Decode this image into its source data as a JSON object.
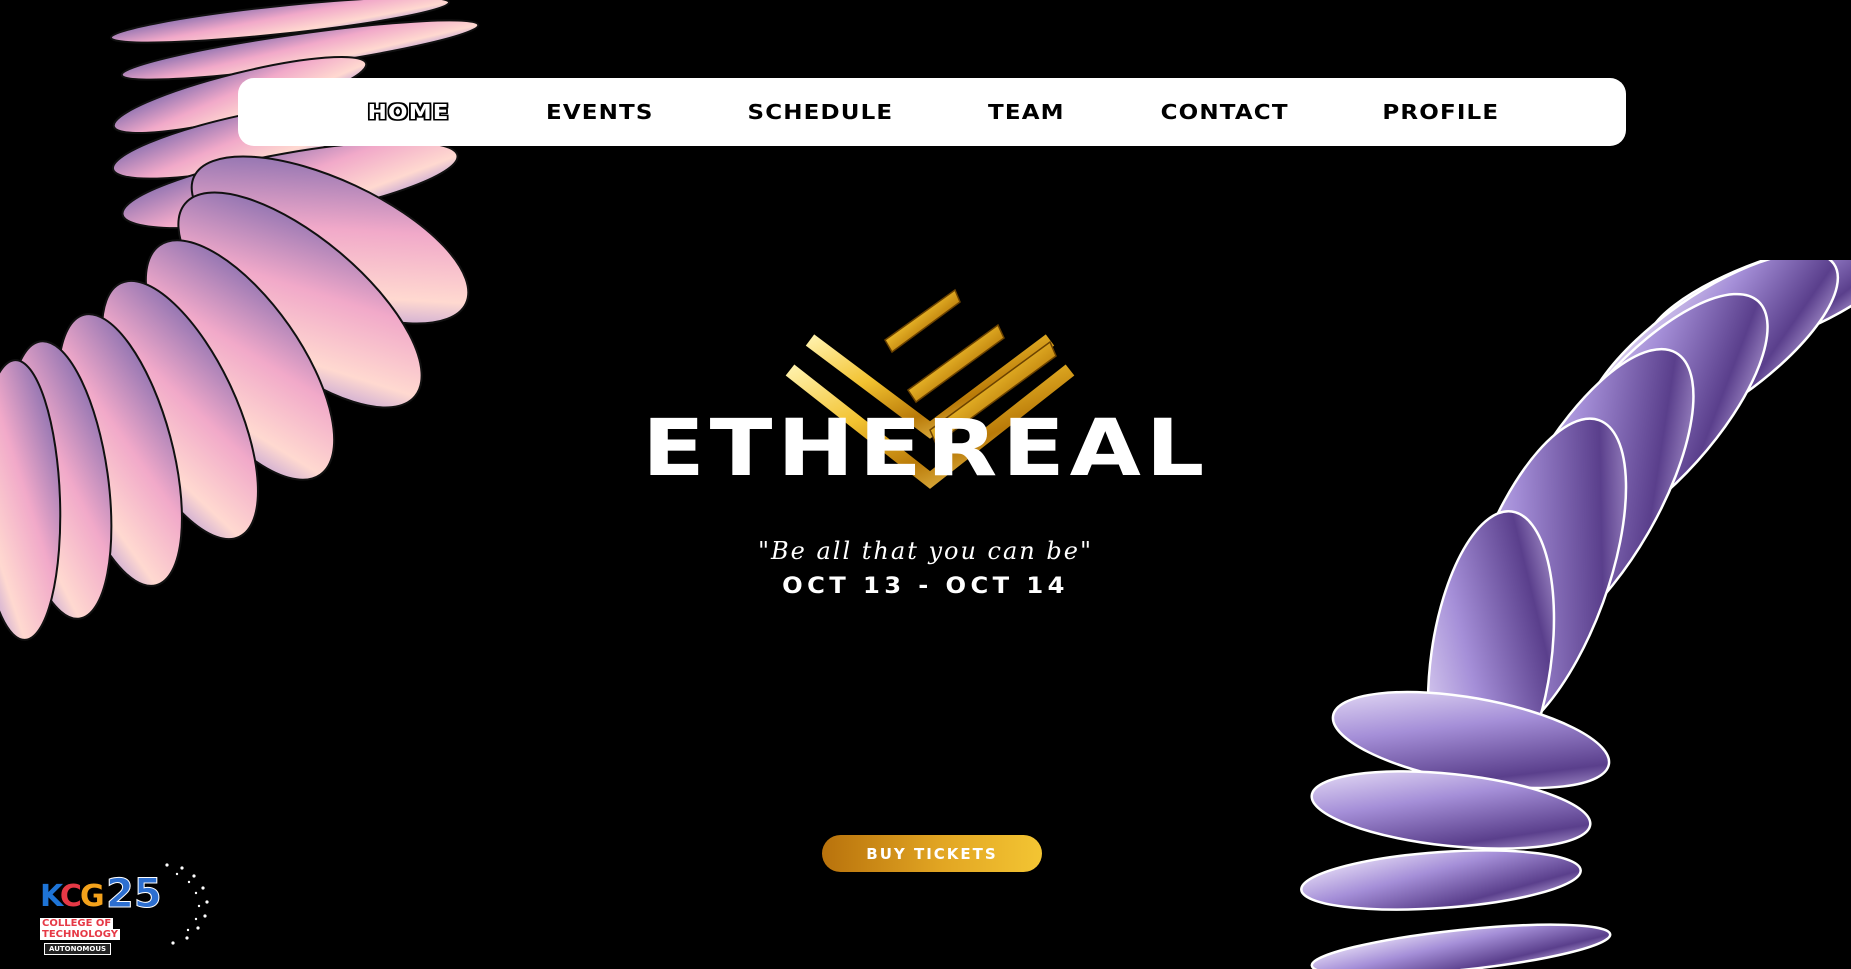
{
  "nav": {
    "items": [
      {
        "label": "HOME",
        "active": true
      },
      {
        "label": "EVENTS"
      },
      {
        "label": "SCHEDULE"
      },
      {
        "label": "TEAM"
      },
      {
        "label": "CONTACT"
      },
      {
        "label": "PROFILE"
      }
    ]
  },
  "hero": {
    "title": "ETHEREAL",
    "tagline": "\"Be all that you can be\"",
    "dates": "OCT 13 - OCT 14",
    "cta_label": "BUY TICKETS"
  },
  "logo": {
    "k": "K",
    "c": "C",
    "g": "G",
    "number": "25",
    "line1": "COLLEGE OF",
    "line2": "TECHNOLOGY",
    "badge": "AUTONOMOUS"
  },
  "colors": {
    "nav_bg": "#ffffff",
    "accent_gold": "#e2a623",
    "background": "#000000"
  }
}
